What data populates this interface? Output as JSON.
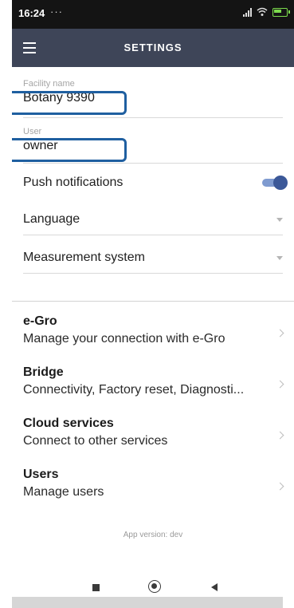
{
  "status_bar": {
    "time": "16:24",
    "dots": "···"
  },
  "app_bar": {
    "title": "SETTINGS"
  },
  "fields": {
    "facility": {
      "label": "Facility name",
      "value": "Botany 9390"
    },
    "user": {
      "label": "User",
      "value": "owner"
    }
  },
  "settings": {
    "push_notifications": {
      "label": "Push notifications",
      "enabled": true
    },
    "language": {
      "label": "Language"
    },
    "measurement_system": {
      "label": "Measurement system"
    }
  },
  "nav_items": [
    {
      "title": "e-Gro",
      "subtitle": "Manage your connection with e-Gro"
    },
    {
      "title": "Bridge",
      "subtitle": "Connectivity, Factory reset, Diagnosti..."
    },
    {
      "title": "Cloud services",
      "subtitle": "Connect to other services"
    },
    {
      "title": "Users",
      "subtitle": "Manage users"
    }
  ],
  "app_version": "App version: dev",
  "colors": {
    "app_bar": "#3e4558",
    "toggle": "#3b5898",
    "highlight": "#1f5fa0"
  },
  "icons": [
    "menu-icon",
    "signal-icon",
    "wifi-icon",
    "battery-icon",
    "dropdown-arrow-icon",
    "chevron-right-icon",
    "square-nav-icon",
    "home-circle-icon",
    "back-triangle-icon"
  ]
}
